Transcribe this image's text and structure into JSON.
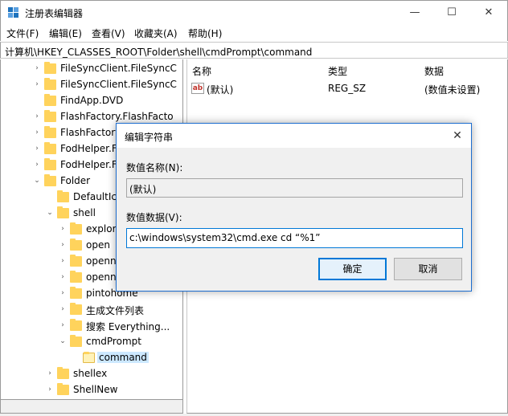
{
  "window": {
    "title": "注册表编辑器",
    "controls": [
      "—",
      "☐",
      "✕"
    ]
  },
  "menu": [
    "文件(F)",
    "编辑(E)",
    "查看(V)",
    "收藏夹(A)",
    "帮助(H)"
  ],
  "address": "计算机\\HKEY_CLASSES_ROOT\\Folder\\shell\\cmdPrompt\\command",
  "tree": [
    {
      "label": "FileSyncClient.FileSyncC",
      "chev": "›"
    },
    {
      "label": "FileSyncClient.FileSyncC",
      "chev": "›"
    },
    {
      "label": "FindApp.DVD",
      "chev": ""
    },
    {
      "label": "FlashFactory.FlashFacto",
      "chev": "›"
    },
    {
      "label": "FlashFactory.F",
      "chev": "›"
    },
    {
      "label": "FodHelper.F",
      "chev": "›"
    },
    {
      "label": "FodHelper.F",
      "chev": "›"
    },
    {
      "label": "Folder",
      "chev": "⌄"
    },
    {
      "label": "DefaultIco",
      "chev": ""
    },
    {
      "label": "shell",
      "chev": "⌄"
    },
    {
      "label": "explor",
      "chev": "›"
    },
    {
      "label": "open",
      "chev": "›"
    },
    {
      "label": "openn",
      "chev": "›"
    },
    {
      "label": "openn",
      "chev": "›"
    },
    {
      "label": "pintohome",
      "chev": "›"
    },
    {
      "label": "生成文件列表",
      "chev": "›"
    },
    {
      "label": "搜索 Everything...",
      "chev": "›"
    },
    {
      "label": "cmdPrompt",
      "chev": "⌄"
    },
    {
      "label": "command",
      "chev": ""
    },
    {
      "label": "shellex",
      "chev": "›"
    },
    {
      "label": "ShellNew",
      "chev": "›"
    }
  ],
  "values_pane": {
    "headers": {
      "name": "名称",
      "type": "类型",
      "data": "数据"
    },
    "rows": [
      {
        "icon": "ab",
        "name": "(默认)",
        "type": "REG_SZ",
        "data": "(数值未设置)"
      }
    ]
  },
  "dialog": {
    "title": "编辑字符串",
    "close": "✕",
    "name_label": "数值名称(N):",
    "name_value": "(默认)",
    "data_label": "数值数据(V):",
    "data_value": "c:\\windows\\system32\\cmd.exe cd “%1”",
    "ok_label": "确定",
    "cancel_label": "取消"
  },
  "colors": {
    "accent": "#0078d7",
    "folder": "#ffd35c",
    "selection": "#cce8ff"
  }
}
